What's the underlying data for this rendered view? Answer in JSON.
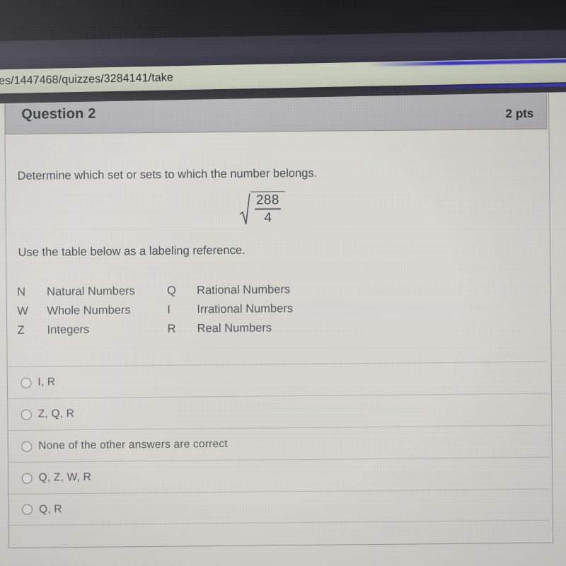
{
  "browser": {
    "url_fragment": "es/1447468/quizzes/3284141/take"
  },
  "question": {
    "title": "Question 2",
    "points": "2 pts",
    "prompt": "Determine which set or sets to which the number belongs.",
    "expression": {
      "radical": "square-root",
      "numerator": "288",
      "denominator": "4"
    },
    "subprompt": "Use the table below as a labeling reference."
  },
  "legend": {
    "rows": [
      {
        "sym1": "N",
        "name1": "Natural Numbers",
        "sym2": "Q",
        "name2": "Rational Numbers"
      },
      {
        "sym1": "W",
        "name1": "Whole Numbers",
        "sym2": "I",
        "name2": "Irrational Numbers"
      },
      {
        "sym1": "Z",
        "name1": "Integers",
        "sym2": "R",
        "name2": "Real Numbers"
      }
    ]
  },
  "answers": {
    "options": [
      {
        "label": "I, R",
        "selected": false
      },
      {
        "label": "Z, Q, R",
        "selected": false
      },
      {
        "label": "None of the other answers are correct",
        "selected": false
      },
      {
        "label": "Q, Z, W, R",
        "selected": false
      },
      {
        "label": "Q, R",
        "selected": false
      }
    ]
  },
  "colors": {
    "page_background": "#d7d6d1",
    "header_band": "#b7b7ba",
    "text": "#4a4f54",
    "divider": "#b6b6b2",
    "bezel_dark": "#1e1e22",
    "urlbar": "#cfd4c2",
    "blue_glow": "#3b35c8"
  }
}
